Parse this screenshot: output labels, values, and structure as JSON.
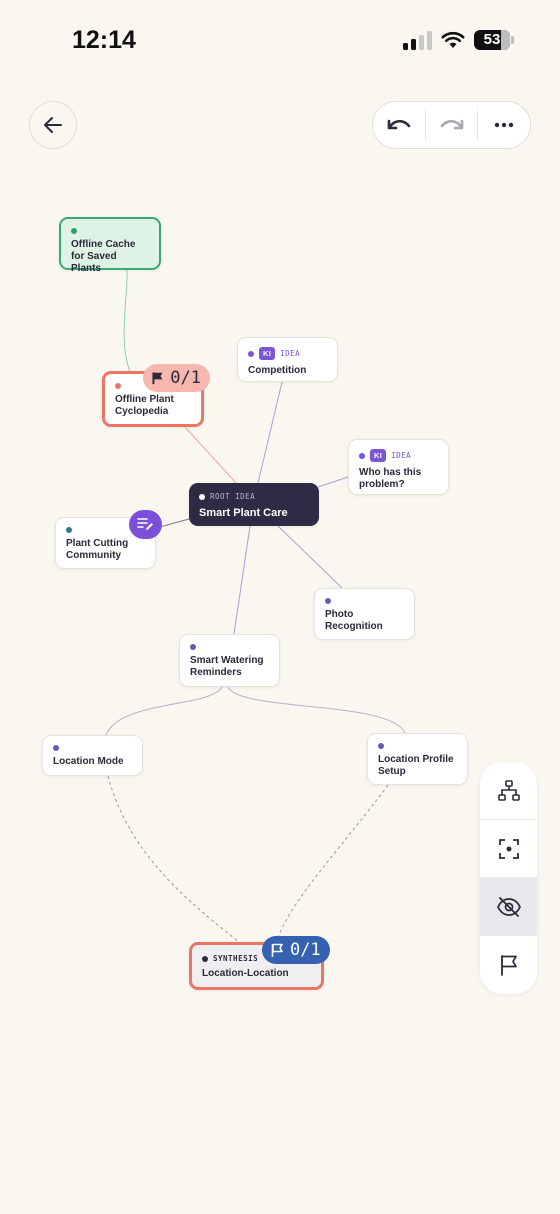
{
  "status_bar": {
    "time": "12:14",
    "battery": "53"
  },
  "toolbar": {
    "back_icon": "arrow-left-icon",
    "undo_icon": "undo-icon",
    "redo_icon": "redo-icon",
    "more_icon": "more-horizontal-icon"
  },
  "colors": {
    "background": "#f9f7f0",
    "accent_purple": "#7b55d6",
    "highlight_red": "#ec7664",
    "root_dark": "#2e2c45",
    "green": "#3aa875",
    "blue": "#3561b0"
  },
  "nodes": {
    "offline_cache": {
      "title": "Offline Cache for Saved Plants"
    },
    "offline_cyclopedia": {
      "title": "Offline Plant Cyclopedia"
    },
    "competition": {
      "ki": "KI",
      "tag": "IDEA",
      "title": "Competition"
    },
    "who_has": {
      "ki": "KI",
      "tag": "IDEA",
      "title": "Who has this problem?"
    },
    "root": {
      "tag": "ROOT IDEA",
      "title": "Smart Plant Care"
    },
    "plant_cutting": {
      "title": "Plant Cutting Community"
    },
    "photo": {
      "title": "Photo Recognition"
    },
    "watering": {
      "title": "Smart Watering Reminders"
    },
    "location_mode": {
      "title": "Location Mode"
    },
    "location_profile": {
      "title": "Location Profile Setup"
    },
    "synthesis": {
      "tag": "SYNTHESIS",
      "title": "Location-Location"
    }
  },
  "badges": {
    "cyclopedia_flag": "0/1",
    "synthesis_flag": "0/1"
  },
  "side_toolbar": [
    "hierarchy-icon",
    "focus-icon",
    "eye-off-icon",
    "flag-icon"
  ]
}
